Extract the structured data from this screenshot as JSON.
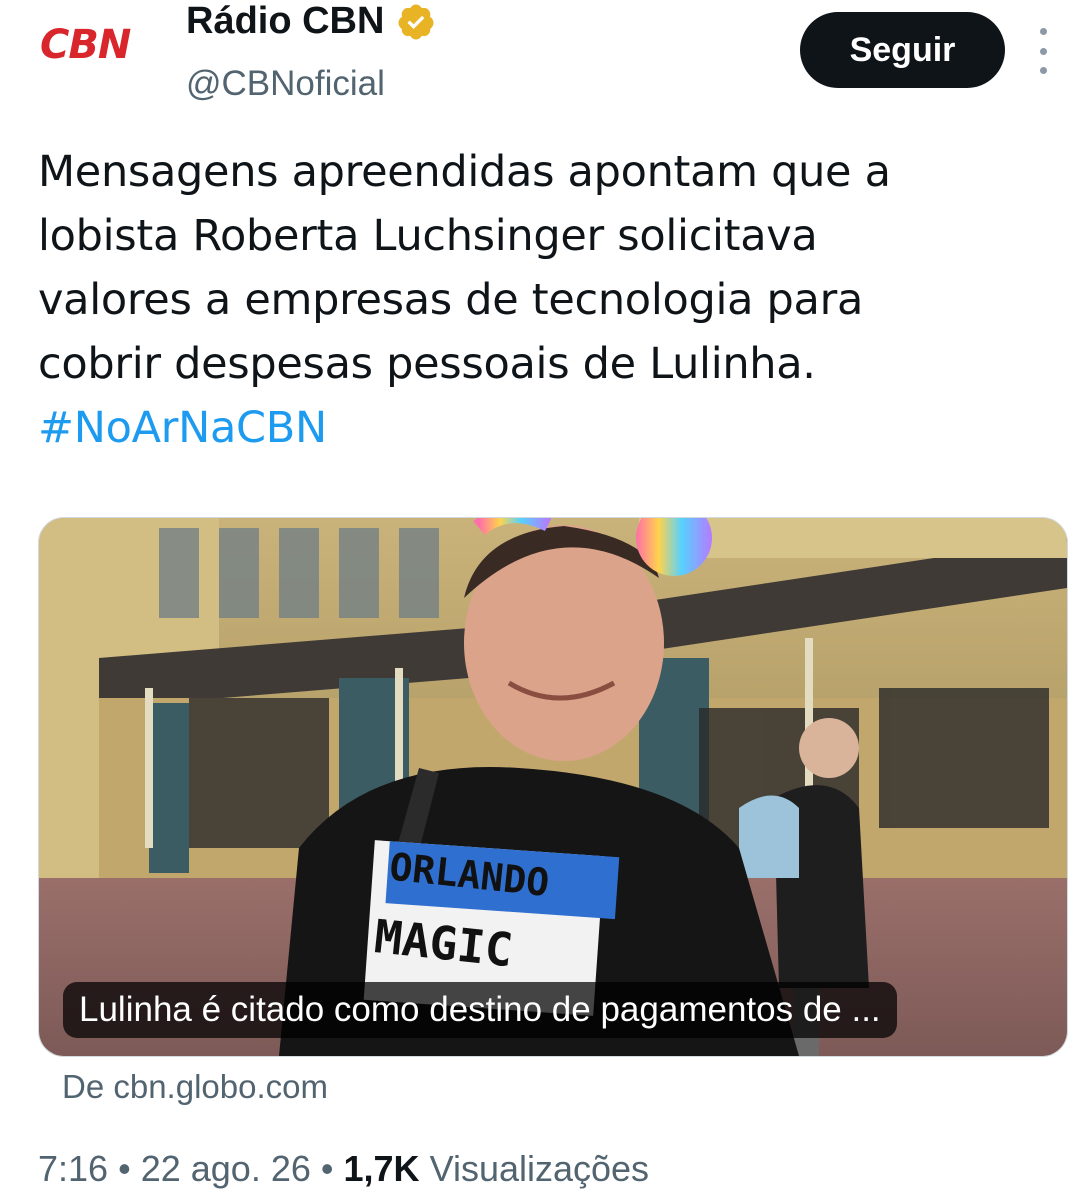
{
  "account": {
    "logo_text": "CBN",
    "display_name": "Rádio CBN",
    "handle": "@CBNoficial",
    "verified_icon": "verified-badge-gold"
  },
  "actions": {
    "follow_label": "Seguir",
    "more_icon": "more-vertical-icon"
  },
  "tweet": {
    "lines": [
      "Mensagens apreendidas apontam que a",
      "lobista Roberta Luchsinger solicitava",
      "valores a empresas de tecnologia para",
      "cobrir despesas pessoais de Lulinha."
    ],
    "hashtag": "#NoArNaCBN"
  },
  "link_card": {
    "shirt_text_top": "ORLANDO",
    "shirt_text_bottom": "MAGIC",
    "caption": "Lulinha é citado como destino de pagamentos de ...",
    "source": "De cbn.globo.com"
  },
  "meta": {
    "time": "7:16",
    "separator": "•",
    "date": "22 ago. 26",
    "views_count": "1,7K",
    "views_label": "Visualizações"
  },
  "colors": {
    "brand_red": "#d9262c",
    "link_blue": "#1d9bf0",
    "text_primary": "#0f1419",
    "text_secondary": "#536471",
    "badge_gold": "#e8b325"
  }
}
